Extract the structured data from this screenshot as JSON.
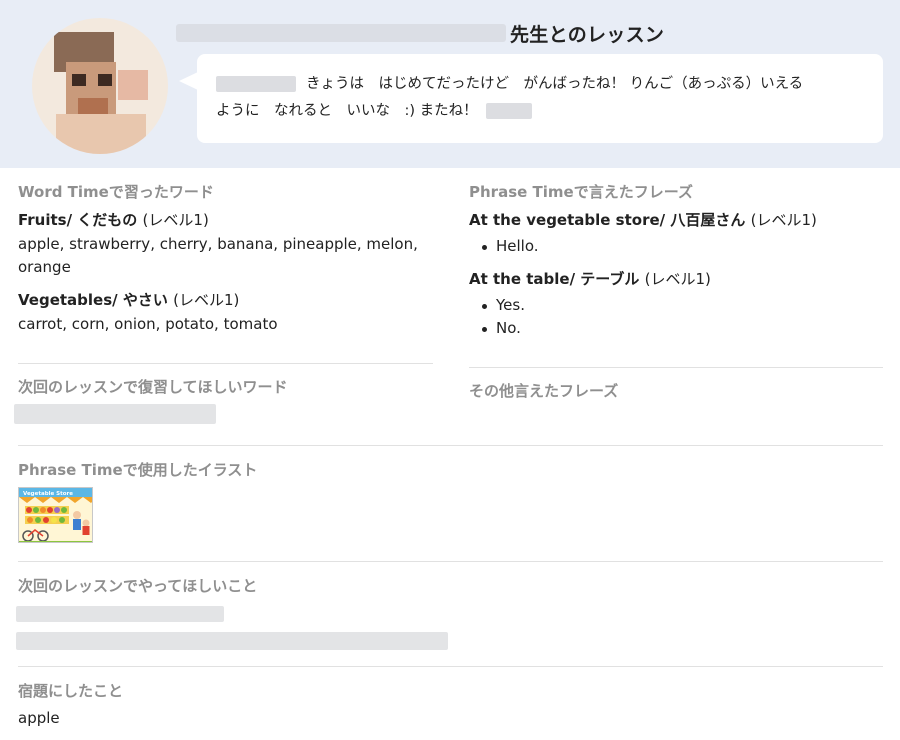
{
  "header": {
    "teacher_suffix": "先生とのレッスン",
    "message_line1": "きょうは　はじめてだったけど　がんばったね！ りんご（あっぷる）いえる",
    "message_line2": "ように　なれると　いいな　:) またね！"
  },
  "left": {
    "word_time_title": "Word Timeで習ったワード",
    "groups": [
      {
        "title": "Fruits/ くだもの",
        "level": "(レベル1)",
        "words_line1": "apple, strawberry, cherry, banana, pineapple, melon,",
        "words_line2": "orange"
      },
      {
        "title": "Vegetables/ やさい",
        "level": "(レベル1)",
        "words_line1": "carrot, corn, onion, potato, tomato"
      }
    ],
    "review_title": "次回のレッスンで復習してほしいワード",
    "illustration_title": "Phrase Timeで使用したイラスト",
    "illustration_caption": "Vegetable Store",
    "request_title": "次回のレッスンでやってほしいこと",
    "homework_title": "宿題にしたこと",
    "homework_value": "apple"
  },
  "right": {
    "phrase_time_title": "Phrase Timeで言えたフレーズ",
    "groups": [
      {
        "title": "At the vegetable store/ 八百屋さん",
        "level": "(レベル1)",
        "phrases": [
          "Hello."
        ]
      },
      {
        "title": "At the table/ テーブル",
        "level": "(レベル1)",
        "phrases": [
          "Yes.",
          "No."
        ]
      }
    ],
    "other_title": "その他言えたフレーズ"
  },
  "colors": {
    "header_bg": "#e8edf6",
    "section_title": "#8f8f8f",
    "divider": "#e1e1e1",
    "text": "#222222"
  }
}
